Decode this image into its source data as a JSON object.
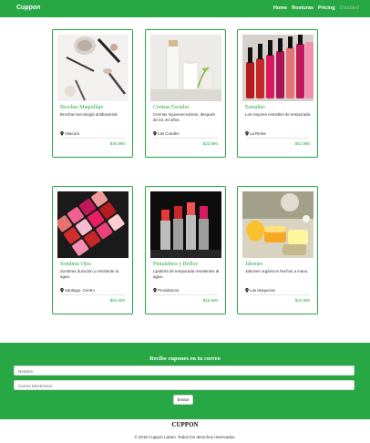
{
  "navbar": {
    "brand": "Cuppon",
    "links": [
      "Home",
      "Rosturas",
      "Pricing",
      "Disabled"
    ]
  },
  "products": [
    {
      "title": "Brochas Maquillaje",
      "desc": "Brochas tecnología antibacterial",
      "location": "Vitacura",
      "price": "$45.990"
    },
    {
      "title": "Cremas Faciales",
      "desc": "Cremas rejuvenecedoras, después de los 40 años.",
      "location": "Las Condes",
      "price": "$33.990"
    },
    {
      "title": "Esmaltes",
      "desc": "Los mejores esmaltes de temporada.",
      "location": "La Reina",
      "price": "$52.990"
    },
    {
      "title": "Sombras Ojos",
      "desc": "Sombras duración y resistente al agua.",
      "location": "Santiago, Centro",
      "price": "$62.600"
    },
    {
      "title": "Pintalabios y Brillos",
      "desc": "Lipsticks de temporada resistentes al agua.",
      "location": "Providencia",
      "price": "$15.500"
    },
    {
      "title": "Jabones",
      "desc": "Jabones orgánicos hechos a mano.",
      "location": "Las tanqueras",
      "price": "$42.990"
    }
  ],
  "coupon": {
    "title": "Recibe cupones en tu correo",
    "name_placeholder": "Nombre",
    "email_placeholder": "Correo Electronico",
    "submit_label": "Enviar"
  },
  "footer": {
    "brand": "CUPPON",
    "copyright": "© 2018 Cuppon Latam. Todos los derechos reservados."
  },
  "colors": {
    "accent": "#28a745"
  }
}
